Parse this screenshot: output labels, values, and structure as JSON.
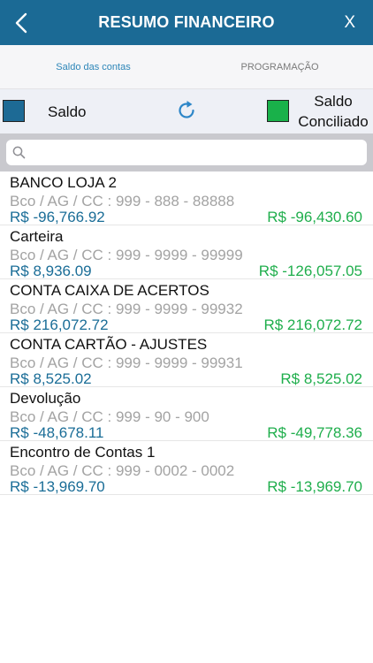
{
  "header": {
    "title": "RESUMO FINANCEIRO",
    "close_label": "X",
    "back_icon": "chevron-left-icon"
  },
  "tabs": [
    {
      "label": "Saldo das contas",
      "active": true
    },
    {
      "label": "PROGRAMAÇÃO",
      "active": false
    }
  ],
  "legend": {
    "saldo_label": "Saldo",
    "saldo_color": "#1d6a95",
    "conciliado_label_line1": "Saldo",
    "conciliado_label_line2": "Conciliado",
    "conciliado_color": "#19b14a",
    "refresh_icon": "refresh-icon"
  },
  "search": {
    "placeholder": "",
    "value": ""
  },
  "accounts": [
    {
      "name": "BANCO LOJA 2",
      "info": "Bco / AG / CC : 999 - 888 - 88888",
      "saldo": "R$ -96,766.92",
      "conciliado": "R$ -96,430.60"
    },
    {
      "name": "Carteira",
      "info": "Bco / AG / CC : 999 - 9999 - 99999",
      "saldo": "R$ 8,936.09",
      "conciliado": "R$ -126,057.05"
    },
    {
      "name": "CONTA CAIXA DE ACERTOS",
      "info": "Bco / AG / CC : 999 - 9999 - 99932",
      "saldo": "R$ 216,072.72",
      "conciliado": "R$ 216,072.72"
    },
    {
      "name": "CONTA CARTÃO - AJUSTES",
      "info": "Bco / AG / CC : 999 - 9999 - 99931",
      "saldo": "R$ 8,525.02",
      "conciliado": "R$ 8,525.02"
    },
    {
      "name": "Devolução",
      "info": "Bco / AG / CC : 999 - 90 - 900",
      "saldo": "R$ -48,678.11",
      "conciliado": "R$ -49,778.36"
    },
    {
      "name": "Encontro de Contas 1",
      "info": "Bco / AG / CC : 999 - 0002 - 0002",
      "saldo": "R$ -13,969.70",
      "conciliado": "R$ -13,969.70"
    }
  ]
}
